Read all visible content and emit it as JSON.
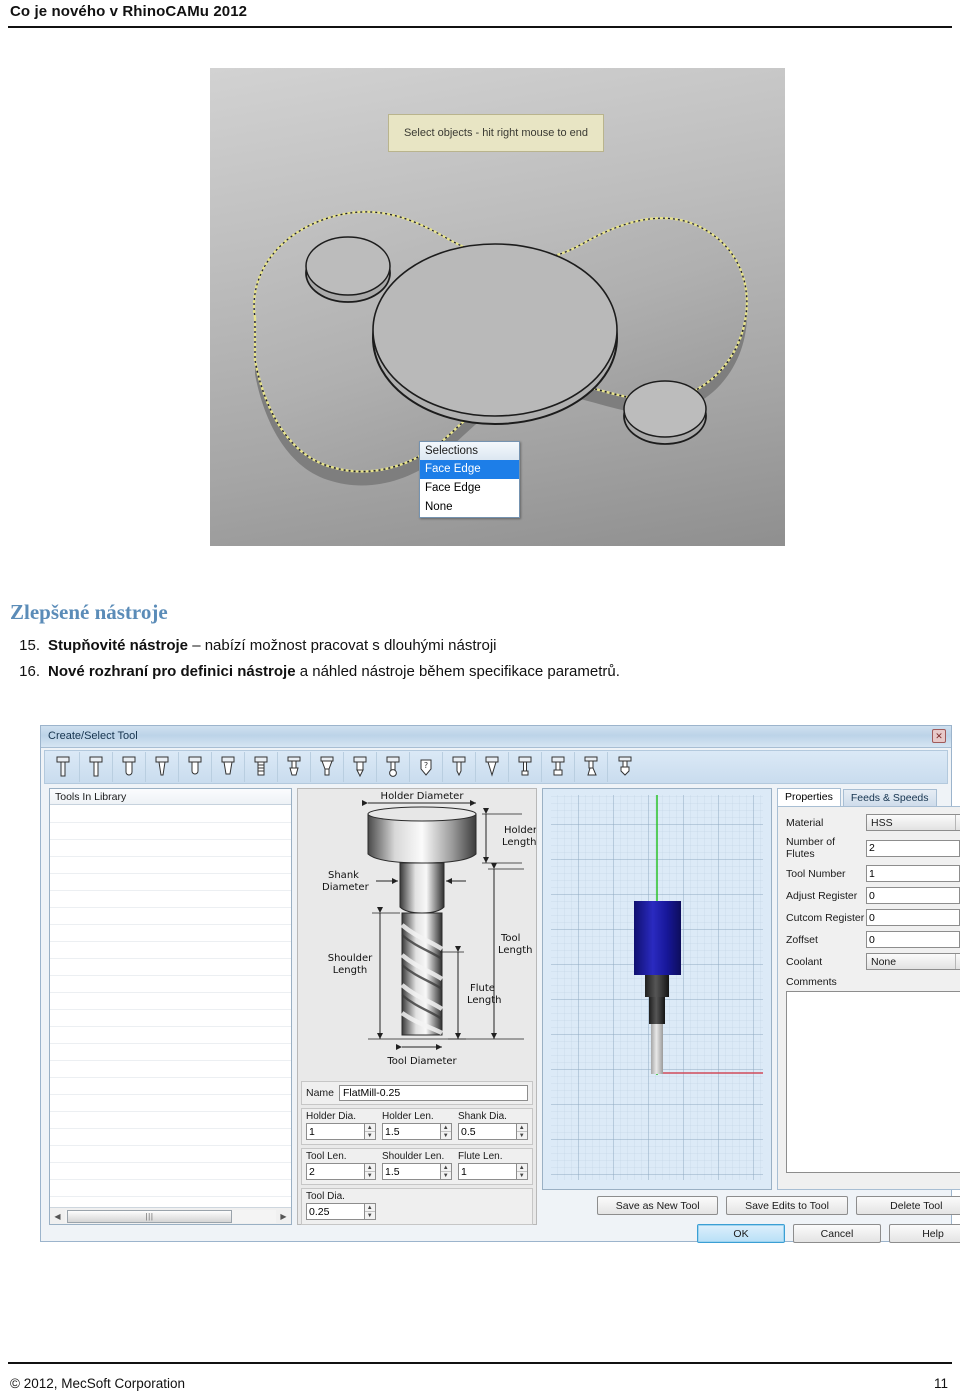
{
  "header": {
    "title": "Co je nového v RhinoCAMu 2012"
  },
  "figure_viewport": {
    "tooltip": "Select objects - hit right mouse to end",
    "selection_menu": {
      "header": "Selections",
      "items": [
        {
          "label": "Face Edge",
          "selected": true
        },
        {
          "label": "Face Edge",
          "selected": false
        },
        {
          "label": "None",
          "selected": false
        }
      ]
    },
    "colors": {
      "highlight_edge": "#e4e08a",
      "background_top": "#d2d2d2",
      "background_bottom": "#8f8f8f",
      "part_fill": "#b3b3b3"
    }
  },
  "section": {
    "title": "Zlepšené nástroje",
    "items": [
      {
        "number": "15.",
        "bold": "Stupňovité nástroje",
        "rest": " – nabízí možnost pracovat s dlouhými nástroji"
      },
      {
        "number": "16.",
        "bold": "Nové rozhraní pro definici nástroje",
        "rest": " a náhled nástroje během specifikace parametrů."
      }
    ]
  },
  "dialog": {
    "title": "Create/Select Tool",
    "close_label": "✕",
    "toolbar": {
      "icons": [
        "flat-mill-icon",
        "flat-mill-2-icon",
        "corner-radius-mill-icon",
        "taper-mill-icon",
        "ball-mill-icon",
        "bull-mill-icon",
        "thread-mill-icon",
        "dovetail-mill-icon",
        "taper-chamfer-icon",
        "drill-icon",
        "spot-drill-icon",
        "unknown-tool-icon",
        "engrave-tool-icon",
        "vee-tool-icon",
        "lollipop-tool-icon",
        "slot-mill-icon",
        "back-chamfer-icon",
        "undercut-tool-icon"
      ]
    },
    "library": {
      "header": "Tools In Library",
      "rows": [],
      "scroll_left_icon": "◀",
      "scroll_right_icon": "▶",
      "thumb_grip": "|||"
    },
    "diagram": {
      "labels": {
        "holder_diameter": "Holder Diameter",
        "holder_length": "Holder\nLength",
        "shank_diameter": "Shank\nDiameter",
        "tool_length": "Tool\nLength",
        "shoulder_length": "Shoulder\nLength",
        "flute_length": "Flute\nLength",
        "tool_diameter": "Tool Diameter"
      }
    },
    "parameters": {
      "name_label": "Name",
      "name_value": "FlatMill-0.25",
      "group1": [
        {
          "label": "Holder Dia.",
          "value": "1"
        },
        {
          "label": "Holder Len.",
          "value": "1.5"
        },
        {
          "label": "Shank Dia.",
          "value": "0.5"
        }
      ],
      "group2": [
        {
          "label": "Tool Len.",
          "value": "2"
        },
        {
          "label": "Shoulder Len.",
          "value": "1.5"
        },
        {
          "label": "Flute Len.",
          "value": "1"
        }
      ],
      "group3": [
        {
          "label": "Tool Dia.",
          "value": "0.25"
        }
      ],
      "spin_up": "▲",
      "spin_down": "▼"
    },
    "preview": {
      "holder_color": "#1c1c96",
      "shank_color": "#3a3a3a",
      "flute_color": "#c8c8c8",
      "axis_vertical_color": "#35c435",
      "axis_horizontal_color": "#d04a5a",
      "grid_color": "#9fb8cf",
      "background": "#dceaf7"
    },
    "properties": {
      "tabs": [
        {
          "label": "Properties",
          "active": true
        },
        {
          "label": "Feeds & Speeds",
          "active": false
        }
      ],
      "material_label": "Material",
      "material_value": "HSS",
      "fields": [
        {
          "label": "Number of Flutes",
          "value": "2"
        },
        {
          "label": "Tool Number",
          "value": "1"
        },
        {
          "label": "Adjust Register",
          "value": "0"
        },
        {
          "label": "Cutcom Register",
          "value": "0"
        },
        {
          "label": "Zoffset",
          "value": "0"
        }
      ],
      "coolant_label": "Coolant",
      "coolant_value": "None",
      "comments_label": "Comments",
      "comments_value": "",
      "dropdown_arrow": "▼"
    },
    "buttons_row1": [
      {
        "label": "Save as New Tool",
        "default": false
      },
      {
        "label": "Save Edits to Tool",
        "default": false
      },
      {
        "label": "Delete Tool",
        "default": false
      }
    ],
    "buttons_row2": [
      {
        "label": "OK",
        "default": true
      },
      {
        "label": "Cancel",
        "default": false
      },
      {
        "label": "Help",
        "default": false
      }
    ]
  },
  "footer": {
    "copyright": "© 2012, MecSoft Corporation",
    "page_number": "11"
  }
}
